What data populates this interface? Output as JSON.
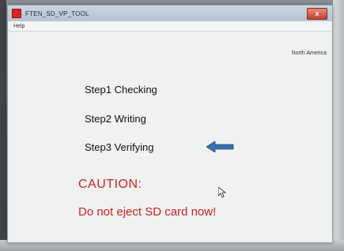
{
  "window": {
    "title": "FTEN_SD_VP_TOOL",
    "close_label": "x"
  },
  "menu": {
    "items": [
      {
        "label": "Help"
      }
    ]
  },
  "content": {
    "region": "North America",
    "steps": [
      {
        "label": "Step1 Checking",
        "active": false
      },
      {
        "label": "Step2 Writing",
        "active": false
      },
      {
        "label": "Step3 Verifying",
        "active": true
      }
    ],
    "caution_title": "CAUTION:",
    "caution_message": "Do not eject SD card now!"
  },
  "colors": {
    "warning_text": "#d21f1f",
    "arrow": "#3a6fb0"
  },
  "icons": {
    "current_step_indicator": "arrow-left-icon",
    "mouse_cursor": "pointer-cursor-icon",
    "app": "app-icon"
  }
}
